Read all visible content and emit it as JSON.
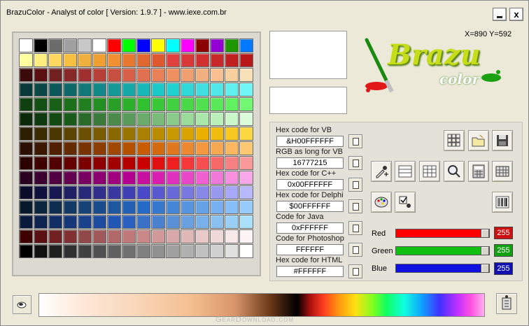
{
  "window": {
    "title": "BrazuColor - Analyst of color [ Version: 1.9.7 ] - www.iexe.com.br",
    "minimize_label": "_",
    "close_label": "x"
  },
  "coords": "X=890   Y=592",
  "logo": {
    "line1": "Brazu",
    "line2": "color"
  },
  "codes": [
    {
      "label": "Hex code for VB",
      "value": "&H00FFFFFF"
    },
    {
      "label": "RGB as long for VB",
      "value": "16777215"
    },
    {
      "label": "Hex code for C++",
      "value": "0x00FFFFFF"
    },
    {
      "label": "Hex code for Delphi",
      "value": "$00FFFFFF"
    },
    {
      "label": "Code for Java",
      "value": "0xFFFFFF"
    },
    {
      "label": "Code for Photoshop",
      "value": "FFFFFF"
    },
    {
      "label": "Hex code for HTML",
      "value": "#FFFFFF"
    }
  ],
  "rgb": {
    "red": {
      "label": "Red",
      "value": "255",
      "level": 1.0,
      "color": "#ff0000"
    },
    "green": {
      "label": "Green",
      "value": "255",
      "level": 1.0,
      "color": "#10c010"
    },
    "blue": {
      "label": "Blue",
      "value": "255",
      "level": 1.0,
      "color": "#1010e0"
    }
  },
  "current_color": "#ffffff",
  "watermark": "GearDownload.com",
  "palette": [
    [
      "#ffffff",
      "#000000",
      "#6b6b6b",
      "#a0a0a0",
      "#c8c8c8",
      "#ffffff",
      "#ff0000",
      "#00ff00",
      "#0000ff",
      "#ffff00",
      "#00ffff",
      "#ff00ff",
      "#8b0000",
      "#9400d3",
      "#1e9600",
      "#0078ff"
    ],
    [
      "#ffffa0",
      "#ffee80",
      "#ffd860",
      "#f8c040",
      "#f0b040",
      "#f0a030",
      "#f09030",
      "#e87830",
      "#e06830",
      "#e05830",
      "#e04040",
      "#d83838",
      "#d03030",
      "#c82828",
      "#c02020",
      "#b81818"
    ],
    [
      "#3a0a0a",
      "#5a1010",
      "#702020",
      "#882828",
      "#a03030",
      "#b84038",
      "#c85040",
      "#d86048",
      "#e07050",
      "#e88058",
      "#f09060",
      "#f0a070",
      "#f0b080",
      "#f8c090",
      "#f8d0a0",
      "#f8e0b8"
    ],
    [
      "#083838",
      "#0a4848",
      "#0c5858",
      "#0e6868",
      "#107878",
      "#128888",
      "#149898",
      "#16a8a8",
      "#18b8b8",
      "#1ac8c8",
      "#20d0d0",
      "#30d8d8",
      "#40e0e0",
      "#50e8e8",
      "#60f0f0",
      "#70f8f8"
    ],
    [
      "#104010",
      "#145014",
      "#186018",
      "#1c701c",
      "#208020",
      "#249024",
      "#28a028",
      "#2cb02c",
      "#30c030",
      "#38c838",
      "#40d040",
      "#48d848",
      "#50e050",
      "#58e858",
      "#60f060",
      "#70f870"
    ],
    [
      "#0a2a0a",
      "#0e3a0e",
      "#124a12",
      "#1a5a1a",
      "#2a6a2a",
      "#3a7a3a",
      "#4a8a4a",
      "#5a9a5a",
      "#6aaa6a",
      "#7aba7a",
      "#8aca8a",
      "#9ada9a",
      "#aae8aa",
      "#baf0ba",
      "#caf8ca",
      "#dafcda"
    ],
    [
      "#2a2000",
      "#3a2c00",
      "#4a3800",
      "#5a4400",
      "#6a5000",
      "#7a5c00",
      "#8a6800",
      "#9a7400",
      "#aa8000",
      "#ba8c00",
      "#ca9800",
      "#daa400",
      "#eab000",
      "#f0bc10",
      "#f8c820",
      "#fcd840"
    ],
    [
      "#2a1000",
      "#3c1800",
      "#502000",
      "#642a00",
      "#783400",
      "#8c3e00",
      "#a04800",
      "#b45200",
      "#c85c00",
      "#d46a10",
      "#e07820",
      "#ec8830",
      "#f49840",
      "#f8a850",
      "#fcb860",
      "#fcc870"
    ],
    [
      "#2a0000",
      "#3e0000",
      "#520000",
      "#660000",
      "#7a0000",
      "#8e0000",
      "#a20000",
      "#b60000",
      "#ca0000",
      "#de1010",
      "#f02020",
      "#f83838",
      "#f85050",
      "#f86868",
      "#f88080",
      "#f89898"
    ],
    [
      "#2a0020",
      "#3c0030",
      "#500040",
      "#640050",
      "#780060",
      "#8c0070",
      "#a00080",
      "#b40090",
      "#c810a0",
      "#d820b0",
      "#e030c0",
      "#e848c8",
      "#f060d0",
      "#f078d8",
      "#f890e0",
      "#f8a8e8"
    ],
    [
      "#0a0a2a",
      "#10103c",
      "#181850",
      "#202064",
      "#282878",
      "#30308c",
      "#3838a0",
      "#4040b4",
      "#4848c8",
      "#5858d0",
      "#6868d8",
      "#7878e0",
      "#8888e8",
      "#9898f0",
      "#a8a8f8",
      "#b8b8fc"
    ],
    [
      "#061a2a",
      "#0a243c",
      "#0e2e50",
      "#123864",
      "#164278",
      "#1a4c8c",
      "#1e56a0",
      "#2260b4",
      "#266ac8",
      "#3678d0",
      "#4686d8",
      "#5694e0",
      "#66a2e8",
      "#76b0f0",
      "#86bef8",
      "#96ccfc"
    ],
    [
      "#0a1a3a",
      "#0e2450",
      "#122e64",
      "#163878",
      "#1a428c",
      "#1e4ca0",
      "#2256b4",
      "#2a60c0",
      "#3a70c8",
      "#4a80d0",
      "#5a90d8",
      "#6aa0e0",
      "#7ab0e8",
      "#8ac0f0",
      "#9ad0f8",
      "#aae0fc"
    ],
    [
      "#400000",
      "#5a1010",
      "#702020",
      "#803030",
      "#904848",
      "#a05858",
      "#b06868",
      "#c07878",
      "#c88888",
      "#d09898",
      "#d8a8a8",
      "#e0b8b8",
      "#e8c8c8",
      "#f0d8d8",
      "#f8e8e8",
      "#fcf4f4"
    ],
    [
      "#000000",
      "#101010",
      "#202020",
      "#303030",
      "#404040",
      "#505050",
      "#606060",
      "#707070",
      "#808080",
      "#909090",
      "#a0a0a0",
      "#b0b0b0",
      "#c0c0c0",
      "#d0d0d0",
      "#e0e0e0",
      "#ffffff"
    ]
  ]
}
